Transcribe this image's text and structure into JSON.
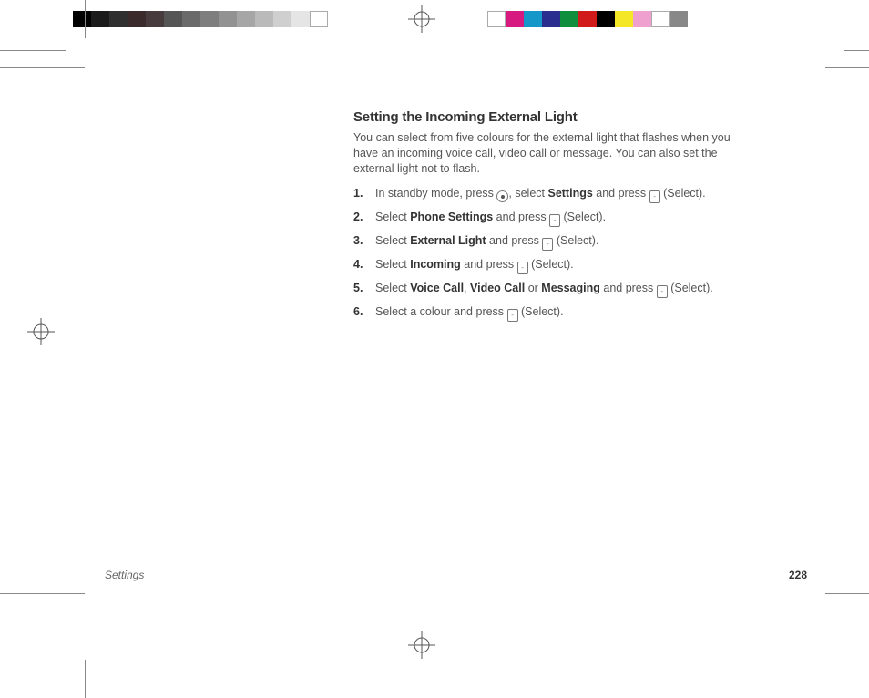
{
  "printer_bars": {
    "left_colors": [
      "#000000",
      "#1b1b1b",
      "#2f2f2f",
      "#3a2a2c",
      "#473b3d",
      "#555555",
      "#6a6a6a",
      "#7e7e7e",
      "#929292",
      "#a6a6a6",
      "#bababa",
      "#cfcfcf",
      "#e5e5e5",
      "#ffffff"
    ],
    "right_colors": [
      "#ffffff",
      "#d61a7f",
      "#1597c9",
      "#2a2f8f",
      "#0f8e3e",
      "#d11a1a",
      "#000000",
      "#f4e727",
      "#efa0cf",
      "#ffffff",
      "#888888"
    ]
  },
  "title": "Setting the Incoming External Light",
  "intro": "You can select from five colours for the external light that flashes when you have an incoming voice call, video call or message. You can also set the external light not to flash.",
  "steps": {
    "s1_a": "In standby mode, press ",
    "s1_b": ", select ",
    "s1_c": " and press ",
    "s1_bold1": "Settings",
    "s2_a": "Select ",
    "s2_bold": "Phone Settings",
    "s2_b": " and press ",
    "s3_a": "Select ",
    "s3_bold": "External Light",
    "s3_b": " and press ",
    "s4_a": "Select ",
    "s4_bold": "Incoming",
    "s4_b": " and press ",
    "s5_a": "Select ",
    "s5_b1": "Voice Call",
    "s5_c": ", ",
    "s5_b2": "Video Call",
    "s5_d": " or ",
    "s5_b3": "Messaging",
    "s5_e": " and press ",
    "s6_a": "Select a colour and press ",
    "select_label": " (Select).",
    "nums": {
      "n1": "1.",
      "n2": "2.",
      "n3": "3.",
      "n4": "4.",
      "n5": "5.",
      "n6": "6."
    }
  },
  "footer": {
    "section": "Settings",
    "page": "228"
  }
}
